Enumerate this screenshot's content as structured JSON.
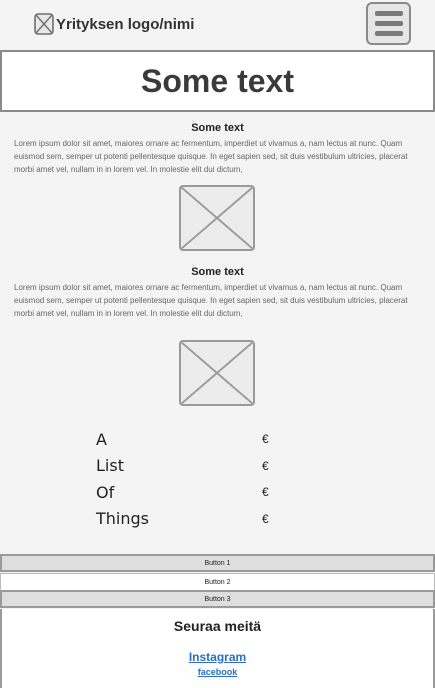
{
  "header": {
    "logo_text": "Yrityksen logo/nimi",
    "logo_icon": "image-placeholder-icon",
    "menu_icon": "hamburger-menu-icon"
  },
  "hero": {
    "title": "Some text"
  },
  "sections": [
    {
      "title": "Some text",
      "body": "Lorem ipsum dolor sit amet, maiores ornare ac fermentum, imperdiet ut vivamus a, nam lectus at nunc. Quam euismod sem, semper ut potenti pellentesque quisque. In eget sapien sed, sit duis vestibulum ultricies, placerat morbi amet vel, nullam in in lorem vel. In molestie elit dui dictum,"
    },
    {
      "title": "Some text",
      "body": "Lorem ipsum dolor sit amet, maiores ornare ac fermentum, imperdiet ut vivamus a, nam lectus at nunc. Quam euismod sem, semper ut potenti pellentesque quisque. In eget sapien sed, sit duis vestibulum ultricies, placerat morbi amet vel, nullam in in lorem vel. In molestie elit dui dictum,"
    }
  ],
  "list": [
    {
      "label": "A",
      "price": "€"
    },
    {
      "label": "List",
      "price": "€"
    },
    {
      "label": "Of",
      "price": "€"
    },
    {
      "label": "Things",
      "price": "€"
    }
  ],
  "buttons": [
    "Button 1",
    "Button 2",
    "Button 3"
  ],
  "footer": {
    "title": "Seuraa meitä",
    "links": [
      "Instagram",
      "facebook"
    ]
  },
  "colors": {
    "link": "#2a6ec7",
    "border": "#9a9a9a",
    "background": "#f4f4f4"
  }
}
